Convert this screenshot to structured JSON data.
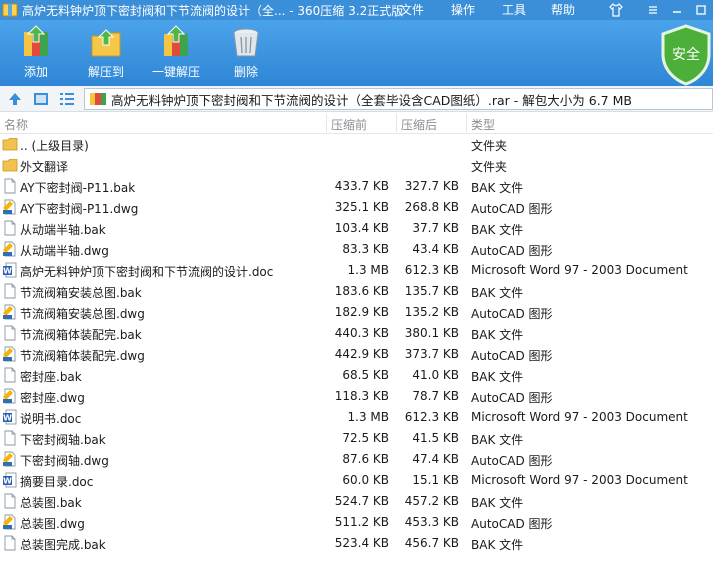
{
  "window": {
    "title": "高炉无料钟炉顶下密封阀和下节流阀的设计（全... - 360压缩 3.2正式版",
    "menu": [
      "文件",
      "操作",
      "工具",
      "帮助"
    ]
  },
  "toolbar": {
    "buttons": [
      {
        "label": "添加",
        "icon": "add-archive-icon"
      },
      {
        "label": "解压到",
        "icon": "extract-to-icon"
      },
      {
        "label": "一键解压",
        "icon": "one-click-extract-icon"
      },
      {
        "label": "删除",
        "icon": "delete-icon"
      }
    ],
    "security_badge": "安全"
  },
  "address": {
    "path": "高炉无料钟炉顶下密封阀和下节流阀的设计（全套毕设含CAD图纸）.rar - 解包大小为 6.7 MB"
  },
  "columns": {
    "name": "名称",
    "packed": "压缩前",
    "unpacked": "压缩后",
    "type": "类型"
  },
  "files": [
    {
      "name": ".. (上级目录)",
      "packed": "",
      "unpacked": "",
      "type": "文件夹",
      "icon": "folder-icon"
    },
    {
      "name": "外文翻译",
      "packed": "",
      "unpacked": "",
      "type": "文件夹",
      "icon": "folder-icon"
    },
    {
      "name": "AY下密封阀-P11.bak",
      "packed": "433.7 KB",
      "unpacked": "327.7 KB",
      "type": "BAK 文件",
      "icon": "file-icon"
    },
    {
      "name": "AY下密封阀-P11.dwg",
      "packed": "325.1 KB",
      "unpacked": "268.8 KB",
      "type": "AutoCAD 图形",
      "icon": "dwg-icon"
    },
    {
      "name": "从动端半轴.bak",
      "packed": "103.4 KB",
      "unpacked": "37.7 KB",
      "type": "BAK 文件",
      "icon": "file-icon"
    },
    {
      "name": "从动端半轴.dwg",
      "packed": "83.3 KB",
      "unpacked": "43.4 KB",
      "type": "AutoCAD 图形",
      "icon": "dwg-icon"
    },
    {
      "name": "高炉无料钟炉顶下密封阀和下节流阀的设计.doc",
      "packed": "1.3 MB",
      "unpacked": "612.3 KB",
      "type": "Microsoft Word 97 - 2003 Document",
      "icon": "word-doc-icon"
    },
    {
      "name": "节流阀箱安装总图.bak",
      "packed": "183.6 KB",
      "unpacked": "135.7 KB",
      "type": "BAK 文件",
      "icon": "file-icon"
    },
    {
      "name": "节流阀箱安装总图.dwg",
      "packed": "182.9 KB",
      "unpacked": "135.2 KB",
      "type": "AutoCAD 图形",
      "icon": "dwg-icon"
    },
    {
      "name": "节流阀箱体装配完.bak",
      "packed": "440.3 KB",
      "unpacked": "380.1 KB",
      "type": "BAK 文件",
      "icon": "file-icon"
    },
    {
      "name": "节流阀箱体装配完.dwg",
      "packed": "442.9 KB",
      "unpacked": "373.7 KB",
      "type": "AutoCAD 图形",
      "icon": "dwg-icon"
    },
    {
      "name": "密封座.bak",
      "packed": "68.5 KB",
      "unpacked": "41.0 KB",
      "type": "BAK 文件",
      "icon": "file-icon"
    },
    {
      "name": "密封座.dwg",
      "packed": "118.3 KB",
      "unpacked": "78.7 KB",
      "type": "AutoCAD 图形",
      "icon": "dwg-icon"
    },
    {
      "name": "说明书.doc",
      "packed": "1.3 MB",
      "unpacked": "612.3 KB",
      "type": "Microsoft Word 97 - 2003 Document",
      "icon": "word-doc-icon"
    },
    {
      "name": "下密封阀轴.bak",
      "packed": "72.5 KB",
      "unpacked": "41.5 KB",
      "type": "BAK 文件",
      "icon": "file-icon"
    },
    {
      "name": "下密封阀轴.dwg",
      "packed": "87.6 KB",
      "unpacked": "47.4 KB",
      "type": "AutoCAD 图形",
      "icon": "dwg-icon"
    },
    {
      "name": "摘要目录.doc",
      "packed": "60.0 KB",
      "unpacked": "15.1 KB",
      "type": "Microsoft Word 97 - 2003 Document",
      "icon": "word-doc-icon"
    },
    {
      "name": "总装图.bak",
      "packed": "524.7 KB",
      "unpacked": "457.2 KB",
      "type": "BAK 文件",
      "icon": "file-icon"
    },
    {
      "name": "总装图.dwg",
      "packed": "511.2 KB",
      "unpacked": "453.3 KB",
      "type": "AutoCAD 图形",
      "icon": "dwg-icon"
    },
    {
      "name": "总装图完成.bak",
      "packed": "523.4 KB",
      "unpacked": "456.7 KB",
      "type": "BAK 文件",
      "icon": "file-icon"
    }
  ],
  "colors": {
    "titlebar": "#3b8fd9",
    "toolbar": "#2f86d6",
    "shield": "#4caf3a",
    "folder": "#f2c14e"
  }
}
